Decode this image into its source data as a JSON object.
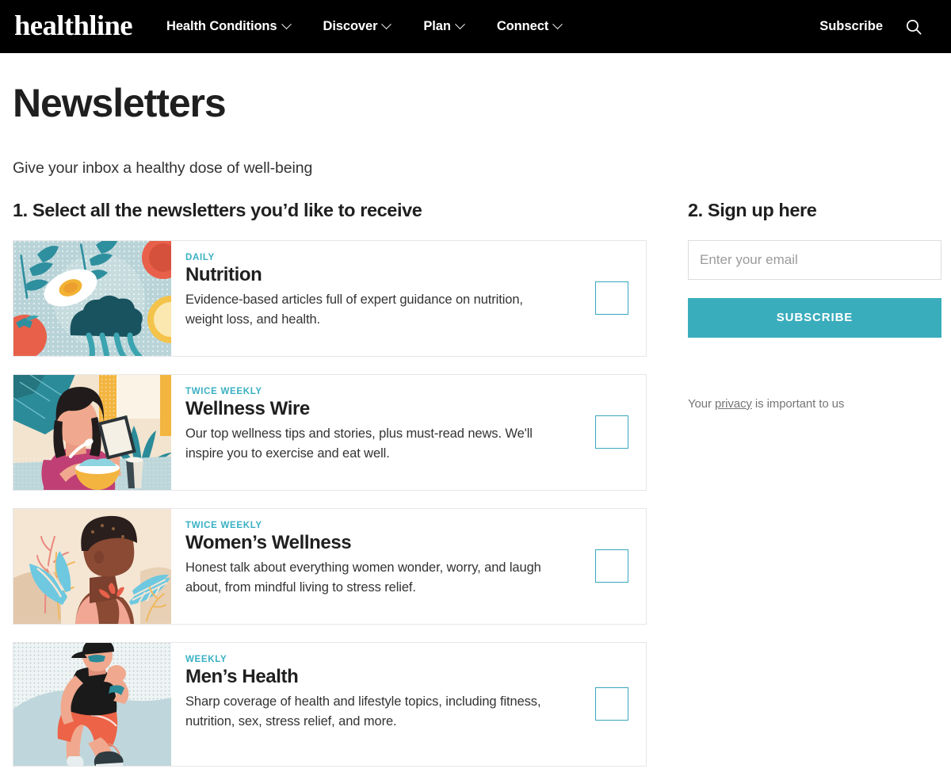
{
  "header": {
    "logo_text": "healthline",
    "nav_items": [
      {
        "label": "Health Conditions",
        "icon": "chevron-down-icon"
      },
      {
        "label": "Discover",
        "icon": "chevron-down-icon"
      },
      {
        "label": "Plan",
        "icon": "chevron-down-icon"
      },
      {
        "label": "Connect",
        "icon": "chevron-down-icon"
      }
    ],
    "subscribe_label": "Subscribe",
    "search_icon": "search-icon"
  },
  "main": {
    "page_title": "Newsletters",
    "subtitle": "Give your inbox a healthy dose of well-being",
    "left_heading": "1. Select all the newsletters you’d like to receive",
    "right_heading": "2. Sign up here"
  },
  "newsletters": [
    {
      "kicker": "DAILY",
      "title": "Nutrition",
      "description": "Evidence-based articles full of expert guidance on nutrition, weight loss, and health.",
      "checked": false,
      "thumb": "nutrition-illustration"
    },
    {
      "kicker": "TWICE WEEKLY",
      "title": "Wellness Wire",
      "description": "Our top wellness tips and stories, plus must-read news. We'll inspire you to exercise and eat well.",
      "checked": false,
      "thumb": "wellness-wire-illustration"
    },
    {
      "kicker": "TWICE WEEKLY",
      "title": "Women’s Wellness",
      "description": "Honest talk about everything women wonder, worry, and laugh about, from mindful living to stress relief.",
      "checked": false,
      "thumb": "womens-wellness-illustration"
    },
    {
      "kicker": "WEEKLY",
      "title": "Men’s Health",
      "description": "Sharp coverage of health and lifestyle topics, including fitness, nutrition, sex, stress relief, and more.",
      "checked": false,
      "thumb": "mens-health-illustration"
    }
  ],
  "signup": {
    "email_placeholder": "Enter your email",
    "email_value": "",
    "subscribe_button_label": "SUBSCRIBE",
    "privacy_prefix": "Your ",
    "privacy_link_label": "privacy",
    "privacy_suffix": " is important to us"
  },
  "colors": {
    "brand_teal": "#3aadbd",
    "kicker_teal": "#39b0c3",
    "checkbox_border": "#3aa7bd",
    "header_bg": "#000000",
    "text_dark": "#1f1f1f",
    "text_body": "#333333",
    "muted": "#767676"
  }
}
